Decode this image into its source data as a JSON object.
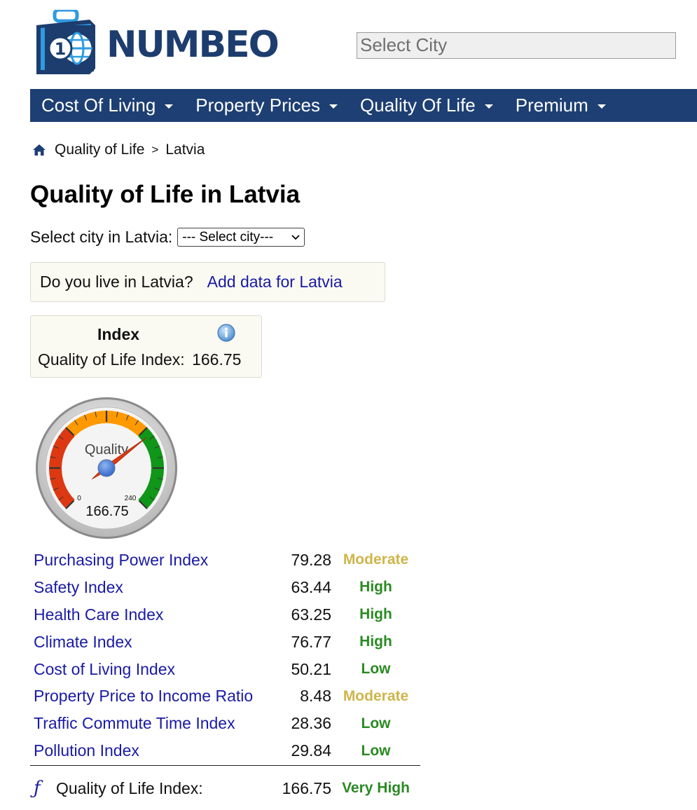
{
  "logo": {
    "text": "NUMBEO",
    "icon": "suitcase-globe-icon"
  },
  "search": {
    "placeholder": "Select City"
  },
  "nav": {
    "items": [
      {
        "label": "Cost Of Living"
      },
      {
        "label": "Property Prices"
      },
      {
        "label": "Quality Of Life"
      },
      {
        "label": "Premium"
      }
    ]
  },
  "breadcrumb": {
    "home_icon": "home-icon",
    "section": "Quality of Life",
    "separator": ">",
    "current": "Latvia"
  },
  "page": {
    "title": "Quality of Life in Latvia"
  },
  "city_select": {
    "label": "Select city in Latvia:",
    "selected": "--- Select city---"
  },
  "live_box": {
    "question": "Do you live in Latvia?",
    "link": "Add data for Latvia"
  },
  "index_box": {
    "header": "Index",
    "label": "Quality of Life Index:",
    "value": "166.75"
  },
  "gauge": {
    "title": "Quality",
    "min_label": "0",
    "max_label": "240",
    "value": 166.75,
    "value_label": "166.75",
    "min": 0,
    "max": 240
  },
  "indices": [
    {
      "name": "Purchasing Power Index",
      "value": "79.28",
      "level": "Moderate",
      "level_color": "#cfb54a"
    },
    {
      "name": "Safety Index",
      "value": "63.44",
      "level": "High",
      "level_color": "#2a8a22"
    },
    {
      "name": "Health Care Index",
      "value": "63.25",
      "level": "High",
      "level_color": "#2a8a22"
    },
    {
      "name": "Climate Index",
      "value": "76.77",
      "level": "High",
      "level_color": "#2a8a22"
    },
    {
      "name": "Cost of Living Index",
      "value": "50.21",
      "level": "Low",
      "level_color": "#2a8a22"
    },
    {
      "name": "Property Price to Income Ratio",
      "value": "8.48",
      "level": "Moderate",
      "level_color": "#cfb54a"
    },
    {
      "name": "Traffic Commute Time Index",
      "value": "28.36",
      "level": "Low",
      "level_color": "#2a8a22"
    },
    {
      "name": "Pollution Index",
      "value": "29.84",
      "level": "Low",
      "level_color": "#2a8a22"
    }
  ],
  "total": {
    "symbol": "ƒ",
    "label": "Quality of Life Index:",
    "value": "166.75",
    "level": "Very High",
    "level_color": "#2a8a22"
  },
  "colors": {
    "nav_bg": "#1d3f73",
    "brand": "#1c3d6e",
    "link": "#1a1aa6"
  }
}
